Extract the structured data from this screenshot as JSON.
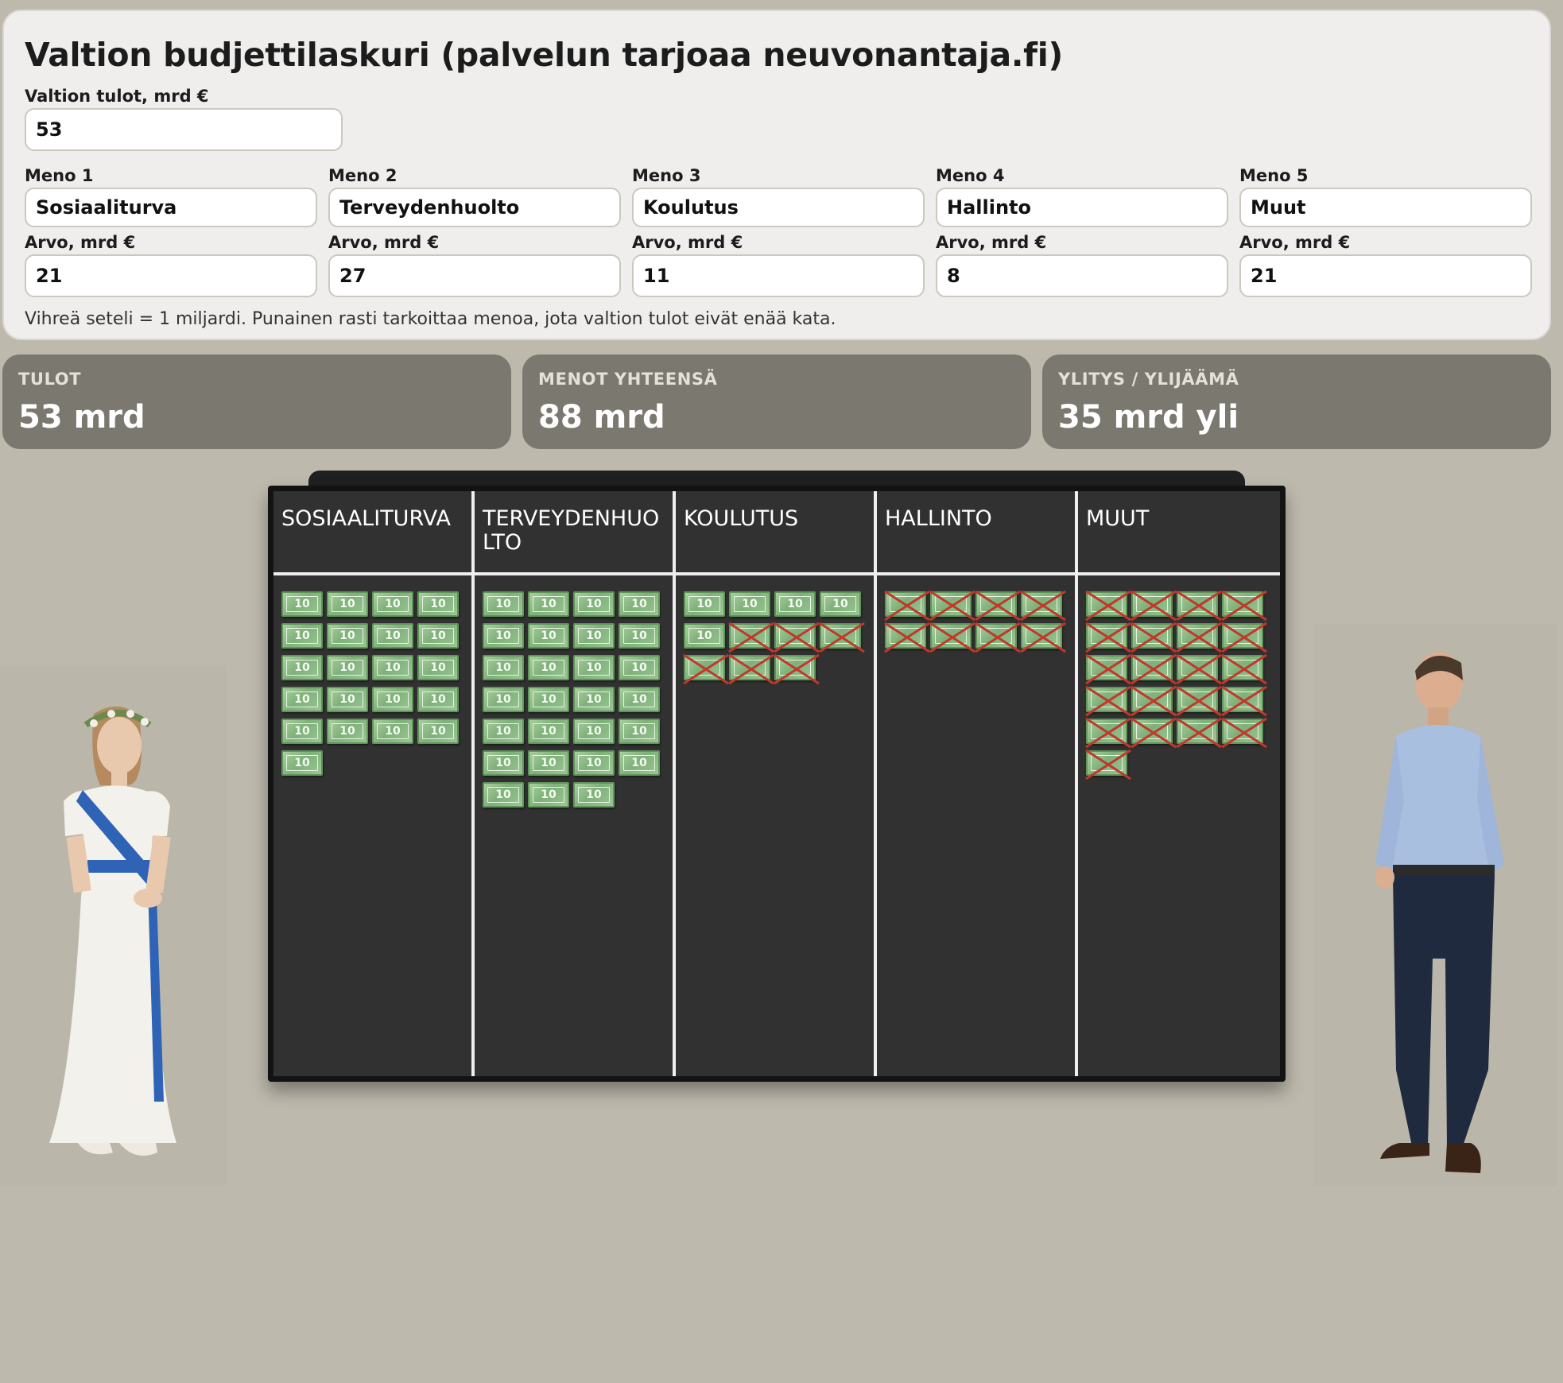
{
  "title": "Valtion budjettilaskuri (palvelun tarjoaa neuvonantaja.fi)",
  "income": {
    "label": "Valtion tulot, mrd €",
    "value": "53"
  },
  "expense_name_labels": [
    "Meno 1",
    "Meno 2",
    "Meno 3",
    "Meno 4",
    "Meno 5"
  ],
  "value_label": "Arvo, mrd €",
  "expenses": [
    {
      "name": "Sosiaaliturva",
      "value": "21"
    },
    {
      "name": "Terveydenhuolto",
      "value": "27"
    },
    {
      "name": "Koulutus",
      "value": "11"
    },
    {
      "name": "Hallinto",
      "value": "8"
    },
    {
      "name": "Muut",
      "value": "21"
    }
  ],
  "note": "Vihreä seteli = 1 miljardi. Punainen rasti tarkoittaa menoa, jota valtion tulot eivät enää kata.",
  "stats": [
    {
      "label": "TULOT",
      "value": "53 mrd"
    },
    {
      "label": "MENOT YHTEENSÄ",
      "value": "88 mrd"
    },
    {
      "label": "YLITYS / YLIJÄÄMÄ",
      "value": "35 mrd yli"
    }
  ],
  "board": {
    "columns": [
      {
        "title": "SOSIAALITURVA",
        "bills": 21,
        "covered": 21
      },
      {
        "title": "TERVEYDENHUOLTO",
        "bills": 27,
        "covered": 27
      },
      {
        "title": "KOULUTUS",
        "bills": 11,
        "covered": 5
      },
      {
        "title": "HALLINTO",
        "bills": 8,
        "covered": 0
      },
      {
        "title": "MUUT",
        "bills": 21,
        "covered": 0
      }
    ],
    "bill_label": "10",
    "bill_color": "#8fbf86",
    "cross_color": "#c0392b"
  },
  "figures": [
    {
      "name": "woman-in-white-dress-figure",
      "icon": "person-standing-icon"
    },
    {
      "name": "man-in-blue-shirt-figure",
      "icon": "person-standing-icon"
    }
  ]
}
